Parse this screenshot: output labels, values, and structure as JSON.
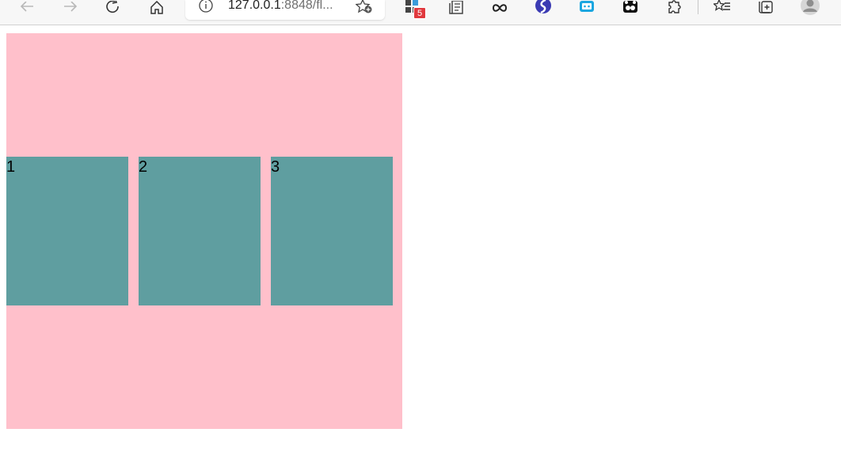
{
  "browser": {
    "url_host": "127.0.0.1",
    "url_rest": ":8848/fl...",
    "extension_badge": "5",
    "icons": {
      "back": "back-arrow-icon",
      "forward": "forward-arrow-icon",
      "refresh": "refresh-icon",
      "home": "home-icon",
      "site_info": "info-icon",
      "add_favorite": "add-favorite-icon",
      "extension_badge_app": "extension-grid-icon",
      "reader": "reader-icon",
      "infinity": "infinity-extension-icon",
      "s_extension": "s-extension-icon",
      "bot_extension": "bot-extension-icon",
      "bear_extension": "bear-extension-icon",
      "extensions": "puzzle-extensions-icon",
      "favorites": "favorites-list-icon",
      "collections": "collections-icon",
      "profile": "profile-avatar-icon"
    }
  },
  "page": {
    "container_color": "#ffc0cb",
    "item_color": "#5f9ea0",
    "items": [
      {
        "label": "1"
      },
      {
        "label": "2"
      },
      {
        "label": "3"
      }
    ]
  }
}
